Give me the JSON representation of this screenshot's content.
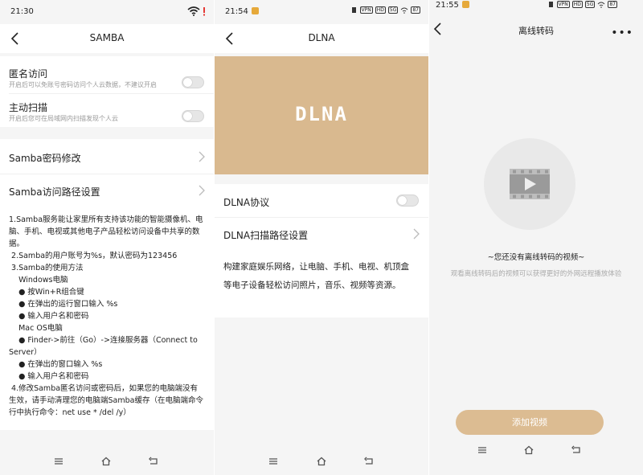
{
  "colors": {
    "accent": "#d9b98f",
    "button": "#dcbc92",
    "background": "#f5f5f5",
    "alert": "#e53935"
  },
  "samba": {
    "status_time": "21:30",
    "title": "SAMBA",
    "anon_title": "匿名访问",
    "anon_sub": "开启后可以免账号密码访问个人云数据，不建议开启",
    "scan_title": "主动扫描",
    "scan_sub": "开启后您可在局域网内扫描发现个人云",
    "pwd_label": "Samba密码修改",
    "path_label": "Samba访问路径设置",
    "lines": [
      "1.Samba服务能让家里所有支持该功能的智能摄像机、电",
      "脑、手机、电视或其他电子产品轻松访问设备中共享的数",
      "据。",
      " 2.Samba的用户账号为%s，默认密码为123456",
      " 3.Samba的使用方法",
      "    Windows电脑",
      "    ● 按Win+R组合键",
      "    ● 在弹出的运行窗口输入 %s",
      "    ● 输入用户名和密码",
      "    Mac OS电脑",
      "    ● Finder->前往（Go）->连接服务器（Connect to",
      "Server）",
      "    ● 在弹出的窗口输入 %s",
      "    ● 输入用户名和密码",
      " 4.修改Samba匿名访问或密码后，如果您的电脑端没有",
      "生效，请手动清理您的电脑端Samba缓存（在电脑端命令",
      "行中执行命令：net use * /del /y）"
    ]
  },
  "dlna": {
    "status_time": "21:54",
    "battery": "87",
    "title": "DLNA",
    "banner_text": "DLNA",
    "protocol_label": "DLNA协议",
    "path_label": "DLNA扫描路径设置",
    "desc_lines": [
      "构建家庭娱乐网络，让电脑、手机、电视、机顶盒",
      "等电子设备轻松访问照片，音乐、视频等资源。"
    ]
  },
  "transcode": {
    "status_time": "21:55",
    "battery": "87",
    "title": "离线转码",
    "more": "•••",
    "empty_title": "~您还没有离线转码的视频~",
    "empty_sub": "观看离线转码后的视频可以获得更好的外网远程播放体验",
    "add_button": "添加视频"
  },
  "icons": [
    "back-icon",
    "wifi-icon",
    "chevron-right-icon",
    "video-icon",
    "menu-icon",
    "home-icon",
    "return-icon",
    "more-icon"
  ]
}
